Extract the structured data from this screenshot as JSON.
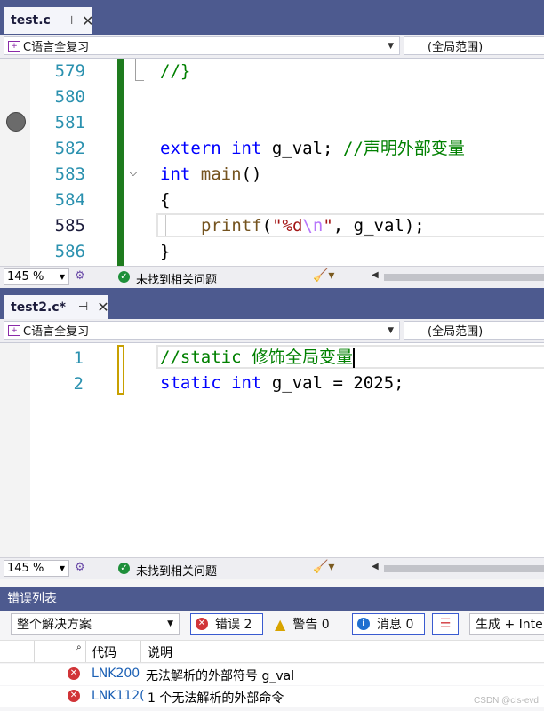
{
  "editor1": {
    "tab": {
      "title": "test.c",
      "pin": "⊣",
      "close": "✕"
    },
    "nav": {
      "project": "C语言全复习",
      "scope": "(全局范围)"
    },
    "lines": [
      {
        "num": "579"
      },
      {
        "num": "580"
      },
      {
        "num": "581"
      },
      {
        "num": "582"
      },
      {
        "num": "583"
      },
      {
        "num": "584"
      },
      {
        "num": "585"
      },
      {
        "num": "586"
      }
    ],
    "code": {
      "l579": "//}",
      "l582_kw1": "extern",
      "l582_kw2": "int",
      "l582_rest": " g_val; ",
      "l582_cm": "//声明外部变量",
      "l583_kw": "int",
      "l583_fn": "main",
      "l583_rest": "()",
      "l584": "{",
      "l585_fn": "printf",
      "l585_open": "(",
      "l585_str1": "\"%d",
      "l585_esc": "\\n",
      "l585_str2": "\"",
      "l585_rest": ", g_val);",
      "l586": "}"
    },
    "status": {
      "zoom": "145 %",
      "issues": "未找到相关问题"
    }
  },
  "editor2": {
    "tab": {
      "title": "test2.c*",
      "pin": "⊣",
      "close": "✕"
    },
    "nav": {
      "project": "C语言全复习",
      "scope": "(全局范围)"
    },
    "lines": [
      {
        "num": "1"
      },
      {
        "num": "2"
      }
    ],
    "code": {
      "l1_cm": "//static 修饰全局变量",
      "l2_kw1": "static",
      "l2_kw2": "int",
      "l2_rest": " g_val = 2025;"
    },
    "status": {
      "zoom": "145 %",
      "issues": "未找到相关问题"
    }
  },
  "error_list": {
    "title": "错误列表",
    "scope": "整个解决方案",
    "errors_btn": "错误 2",
    "warnings_btn": "警告 0",
    "messages_btn": "消息 0",
    "build_filter": "生成 + Inte",
    "columns": {
      "code": "代码",
      "desc": "说明"
    },
    "rows": [
      {
        "code": "LNK200",
        "desc": "无法解析的外部符号 g_val"
      },
      {
        "code": "LNK112(",
        "desc": "1 个无法解析的外部命令"
      }
    ]
  },
  "watermark": "CSDN @cls-evd",
  "colors": {
    "accent": "#4d5a8f",
    "changed_bar": "#1e7b1e",
    "unsaved_bar": "#c8a000"
  }
}
